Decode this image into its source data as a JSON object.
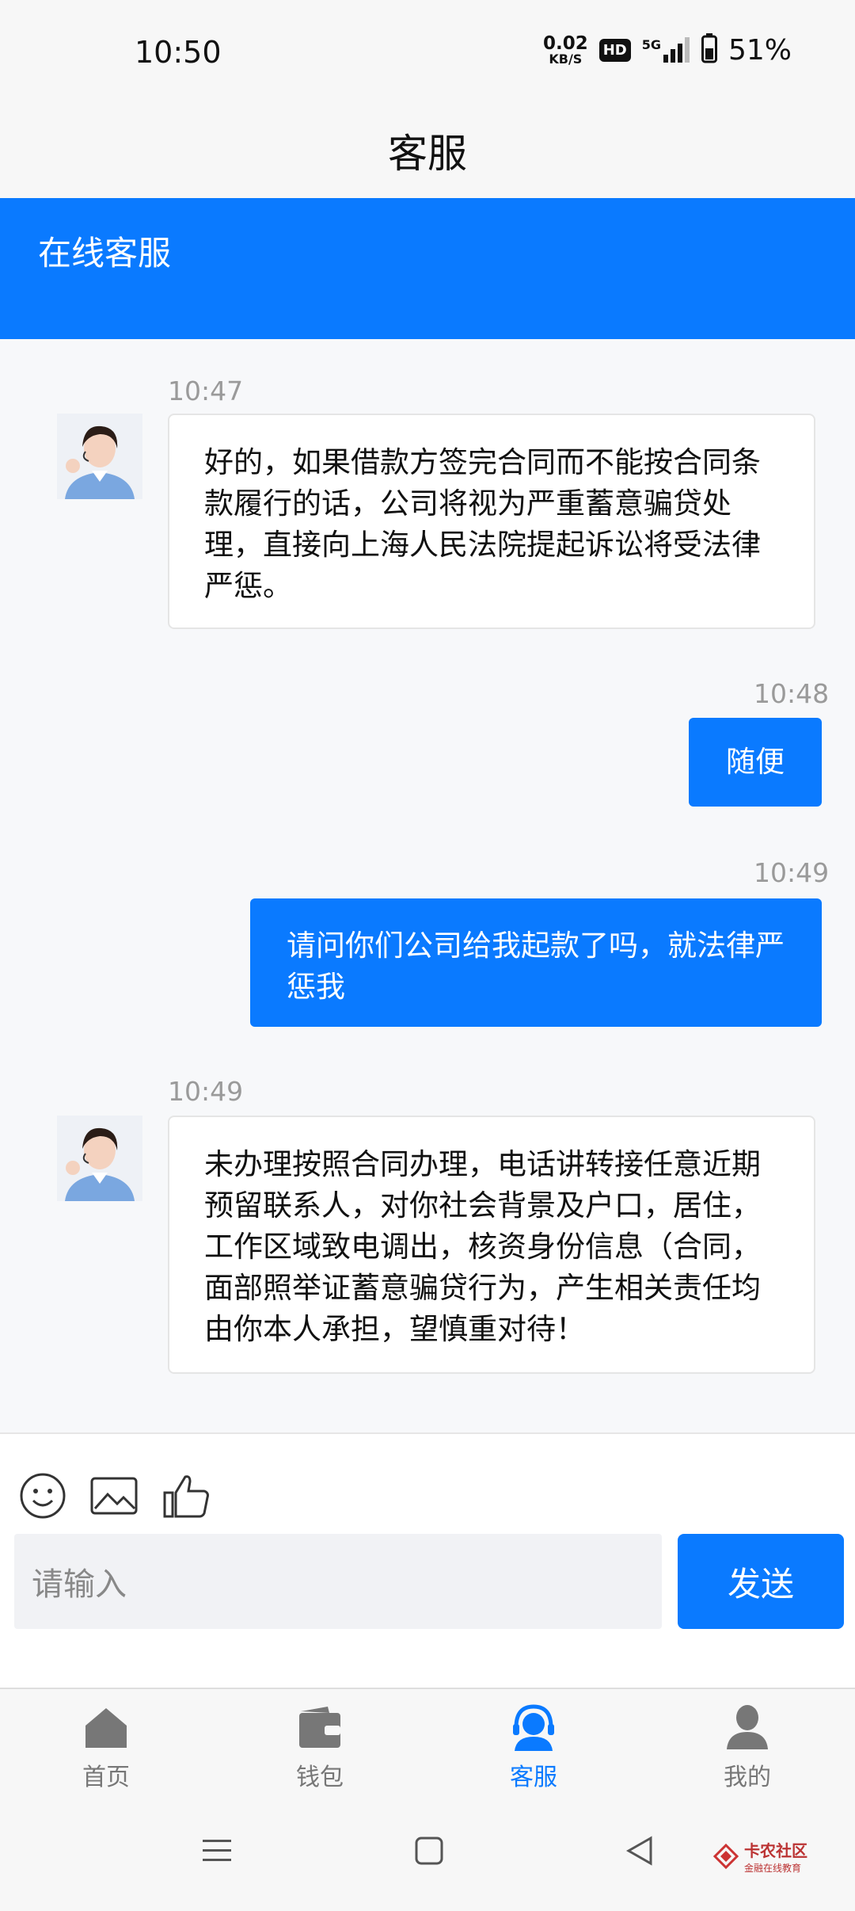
{
  "status_bar": {
    "time": "10:50",
    "net_speed_value": "0.02",
    "net_speed_unit": "KB/S",
    "hd_badge": "HD",
    "network": "5G",
    "battery": "51%"
  },
  "header": {
    "title": "客服"
  },
  "banner": {
    "label": "在线客服"
  },
  "messages": [
    {
      "side": "agent",
      "time": "10:47",
      "text": "好的，如果借款方签完合同而不能按合同条款履行的话，公司将视为严重蓄意骗贷处理，直接向上海人民法院提起诉讼将受法律严惩。"
    },
    {
      "side": "user",
      "time": "10:48",
      "text": "随便"
    },
    {
      "side": "user",
      "time": "10:49",
      "text": "请问你们公司给我起款了吗，就法律严惩我"
    },
    {
      "side": "agent",
      "time": "10:49",
      "text": "未办理按照合同办理，电话讲转接任意近期预留联系人，对你社会背景及户口，居住，工作区域致电调出，核资身份信息（合同，面部照举证蓄意骗贷行为，产生相关责任均由你本人承担，望慎重对待！"
    }
  ],
  "input": {
    "placeholder": "请输入",
    "send_label": "发送"
  },
  "tools": [
    "emoji-icon",
    "image-icon",
    "thumbs-up-icon"
  ],
  "bottom_nav": {
    "items": [
      {
        "label": "首页",
        "icon": "home-icon",
        "active": false
      },
      {
        "label": "钱包",
        "icon": "wallet-icon",
        "active": false
      },
      {
        "label": "客服",
        "icon": "headset-icon",
        "active": true
      },
      {
        "label": "我的",
        "icon": "person-icon",
        "active": false
      }
    ]
  },
  "watermark": {
    "title": "卡农社区",
    "subtitle": "金融在线教育"
  },
  "colors": {
    "accent": "#0a7aff",
    "background": "#f7f7f7"
  }
}
